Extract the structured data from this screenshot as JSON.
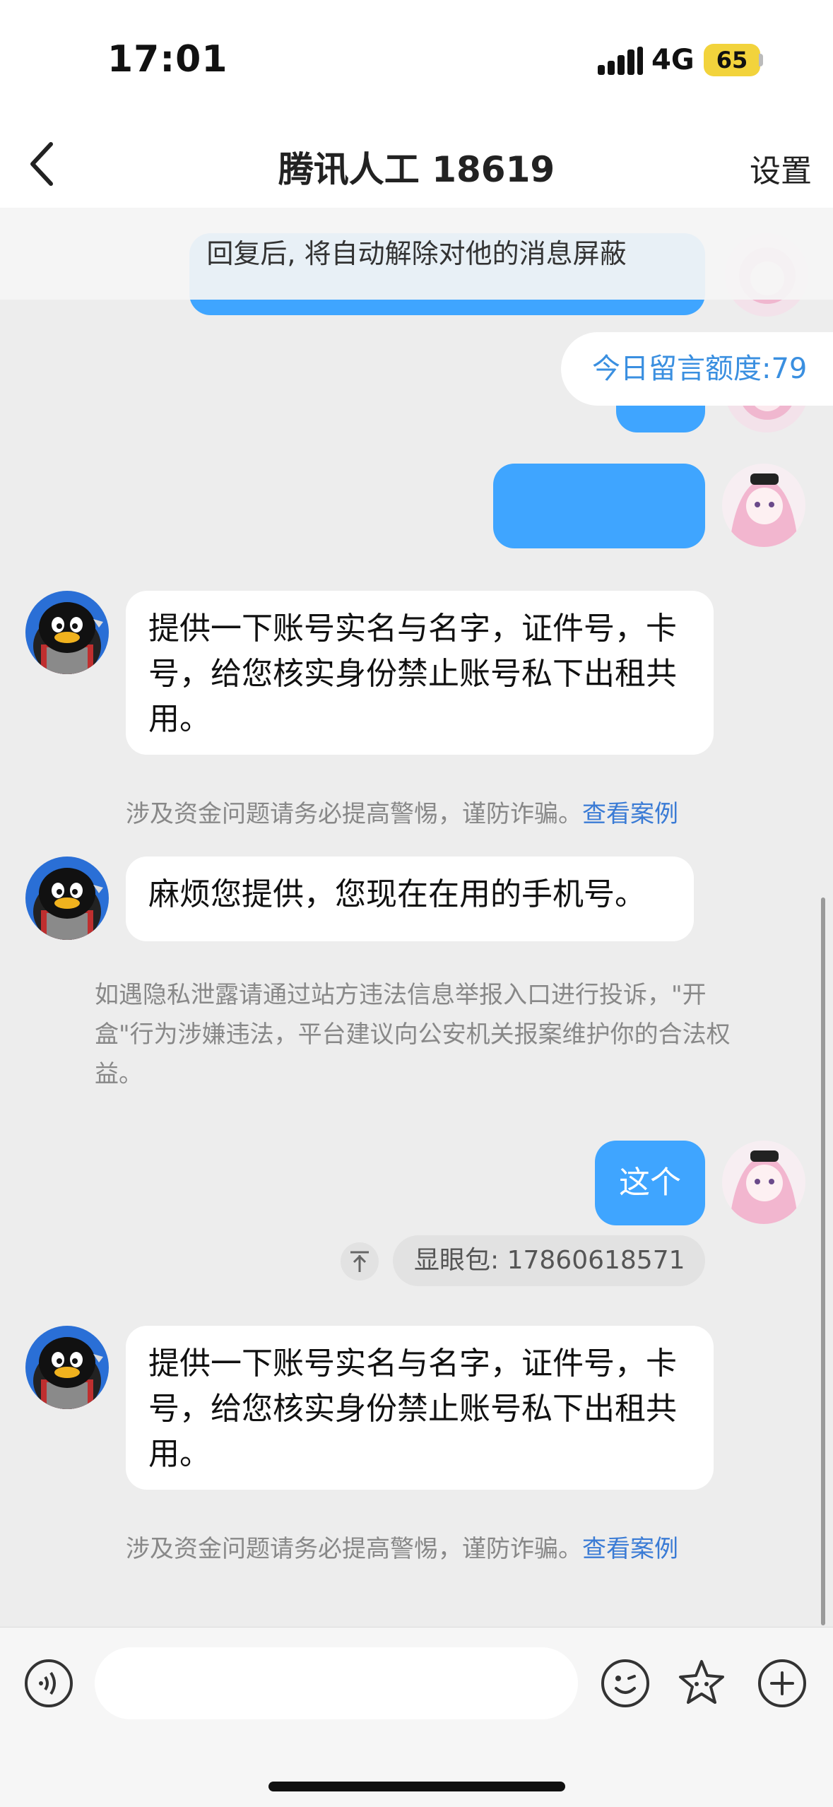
{
  "status_bar": {
    "time": "17:01",
    "network": "4G",
    "battery": "65"
  },
  "header": {
    "title": "腾讯人工 18619",
    "settings_label": "设置"
  },
  "notice": "回复后, 将自动解除对他的消息屏蔽",
  "quota_label": "今日留言额度:79",
  "messages": {
    "bot1": "提供一下账号实名与名字，证件号，卡号，给您核实身份禁止账号私下出租共用。",
    "tip1_text": "涉及资金问题请务必提高警惕，谨防诈骗。",
    "tip1_link": "查看案例",
    "bot2": "麻烦您提供，您现在在用的手机号。",
    "privacy_tip": "如遇隐私泄露请通过站方违法信息举报入口进行投诉，\"开盒\"行为涉嫌违法，平台建议向公安机关报案维护你的合法权益。",
    "self_reply": "这个",
    "quote": "显眼包: 17860618571",
    "bot3": "提供一下账号实名与名字，证件号，卡号，给您核实身份禁止账号私下出租共用。",
    "tip2_text": "涉及资金问题请务必提高警惕，谨防诈骗。",
    "tip2_link": "查看案例"
  },
  "colors": {
    "accent": "#3fa5ff",
    "link": "#3a7bd5",
    "battery": "#f2d33c"
  },
  "icons": [
    "chevron-left-icon",
    "voice-icon",
    "emoji-icon",
    "star-icon",
    "plus-icon"
  ]
}
